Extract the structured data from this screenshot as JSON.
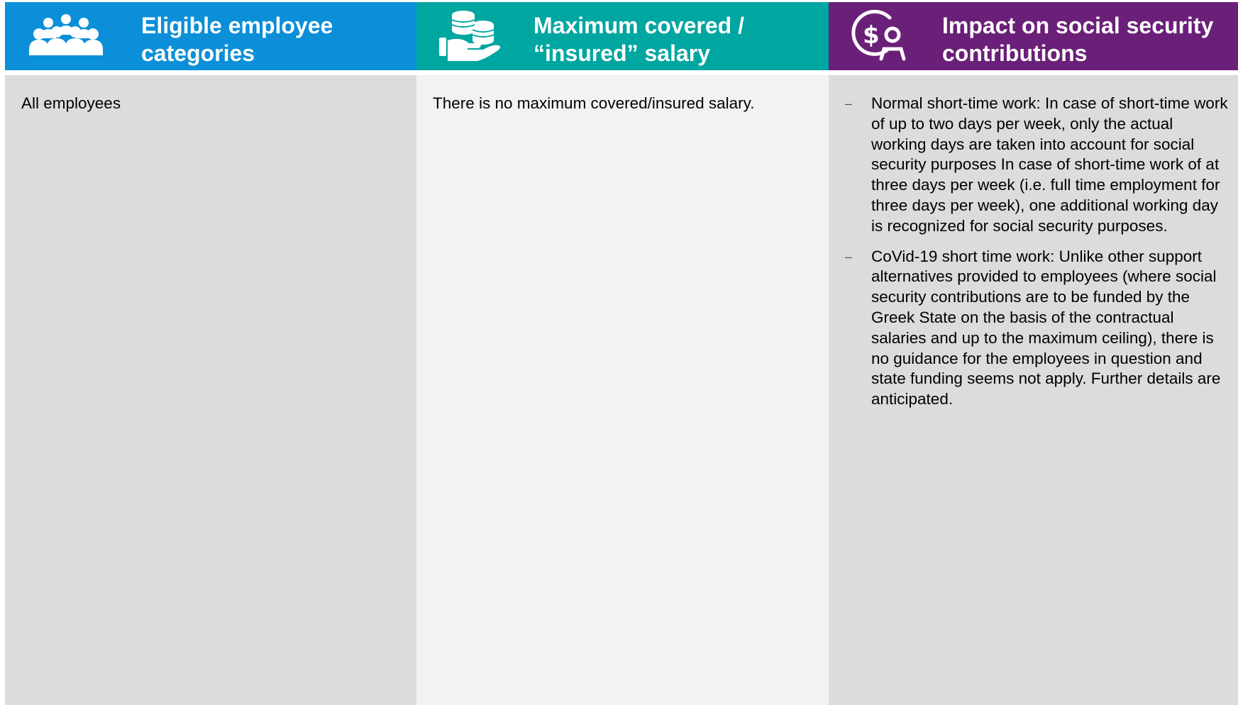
{
  "colors": {
    "header_blue": "#0b8fd8",
    "header_teal": "#00a6a0",
    "header_purple": "#6a1f78",
    "body_grey": "#dcdcdc",
    "body_light": "#f2f2f2"
  },
  "columns": [
    {
      "icon": "people-group-icon",
      "title": "Eligible employee\ncategories",
      "body": "All employees"
    },
    {
      "icon": "coins-hand-icon",
      "title": "Maximum covered /\n“insured” salary",
      "body": "There is no maximum covered/insured salary."
    },
    {
      "icon": "dollar-person-icon",
      "title": "Impact on social security\ncontributions",
      "bullets": [
        "Normal short-time work: In case of short-time work of up to two days per week, only the actual working days are taken into account for social security purposes In case of short-time work of at three days per week (i.e. full time employment for three days per week), one additional working day is recognized for social security purposes.",
        "CoVid-19 short time work: Unlike other support alternatives provided to employees (where social security contributions are to be funded by the Greek State on the basis of the contractual salaries and up to the maximum ceiling), there is no guidance for the employees in question and state funding seems not apply. Further details are anticipated."
      ]
    }
  ],
  "bullet_marker": "–"
}
